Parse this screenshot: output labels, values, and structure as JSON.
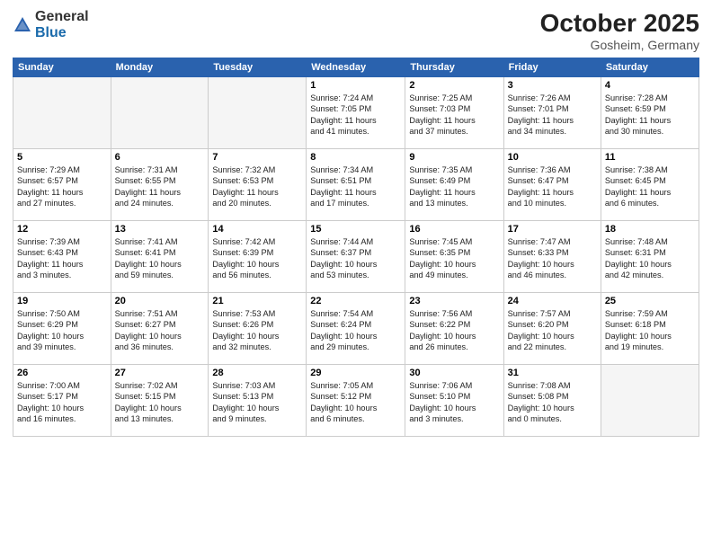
{
  "logo": {
    "general": "General",
    "blue": "Blue"
  },
  "title": {
    "month": "October 2025",
    "location": "Gosheim, Germany"
  },
  "headers": [
    "Sunday",
    "Monday",
    "Tuesday",
    "Wednesday",
    "Thursday",
    "Friday",
    "Saturday"
  ],
  "weeks": [
    [
      {
        "day": "",
        "empty": true
      },
      {
        "day": "",
        "empty": true
      },
      {
        "day": "",
        "empty": true
      },
      {
        "day": "1",
        "lines": [
          "Sunrise: 7:24 AM",
          "Sunset: 7:05 PM",
          "Daylight: 11 hours",
          "and 41 minutes."
        ]
      },
      {
        "day": "2",
        "lines": [
          "Sunrise: 7:25 AM",
          "Sunset: 7:03 PM",
          "Daylight: 11 hours",
          "and 37 minutes."
        ]
      },
      {
        "day": "3",
        "lines": [
          "Sunrise: 7:26 AM",
          "Sunset: 7:01 PM",
          "Daylight: 11 hours",
          "and 34 minutes."
        ]
      },
      {
        "day": "4",
        "lines": [
          "Sunrise: 7:28 AM",
          "Sunset: 6:59 PM",
          "Daylight: 11 hours",
          "and 30 minutes."
        ]
      }
    ],
    [
      {
        "day": "5",
        "lines": [
          "Sunrise: 7:29 AM",
          "Sunset: 6:57 PM",
          "Daylight: 11 hours",
          "and 27 minutes."
        ]
      },
      {
        "day": "6",
        "lines": [
          "Sunrise: 7:31 AM",
          "Sunset: 6:55 PM",
          "Daylight: 11 hours",
          "and 24 minutes."
        ]
      },
      {
        "day": "7",
        "lines": [
          "Sunrise: 7:32 AM",
          "Sunset: 6:53 PM",
          "Daylight: 11 hours",
          "and 20 minutes."
        ]
      },
      {
        "day": "8",
        "lines": [
          "Sunrise: 7:34 AM",
          "Sunset: 6:51 PM",
          "Daylight: 11 hours",
          "and 17 minutes."
        ]
      },
      {
        "day": "9",
        "lines": [
          "Sunrise: 7:35 AM",
          "Sunset: 6:49 PM",
          "Daylight: 11 hours",
          "and 13 minutes."
        ]
      },
      {
        "day": "10",
        "lines": [
          "Sunrise: 7:36 AM",
          "Sunset: 6:47 PM",
          "Daylight: 11 hours",
          "and 10 minutes."
        ]
      },
      {
        "day": "11",
        "lines": [
          "Sunrise: 7:38 AM",
          "Sunset: 6:45 PM",
          "Daylight: 11 hours",
          "and 6 minutes."
        ]
      }
    ],
    [
      {
        "day": "12",
        "lines": [
          "Sunrise: 7:39 AM",
          "Sunset: 6:43 PM",
          "Daylight: 11 hours",
          "and 3 minutes."
        ]
      },
      {
        "day": "13",
        "lines": [
          "Sunrise: 7:41 AM",
          "Sunset: 6:41 PM",
          "Daylight: 10 hours",
          "and 59 minutes."
        ]
      },
      {
        "day": "14",
        "lines": [
          "Sunrise: 7:42 AM",
          "Sunset: 6:39 PM",
          "Daylight: 10 hours",
          "and 56 minutes."
        ]
      },
      {
        "day": "15",
        "lines": [
          "Sunrise: 7:44 AM",
          "Sunset: 6:37 PM",
          "Daylight: 10 hours",
          "and 53 minutes."
        ]
      },
      {
        "day": "16",
        "lines": [
          "Sunrise: 7:45 AM",
          "Sunset: 6:35 PM",
          "Daylight: 10 hours",
          "and 49 minutes."
        ]
      },
      {
        "day": "17",
        "lines": [
          "Sunrise: 7:47 AM",
          "Sunset: 6:33 PM",
          "Daylight: 10 hours",
          "and 46 minutes."
        ]
      },
      {
        "day": "18",
        "lines": [
          "Sunrise: 7:48 AM",
          "Sunset: 6:31 PM",
          "Daylight: 10 hours",
          "and 42 minutes."
        ]
      }
    ],
    [
      {
        "day": "19",
        "lines": [
          "Sunrise: 7:50 AM",
          "Sunset: 6:29 PM",
          "Daylight: 10 hours",
          "and 39 minutes."
        ]
      },
      {
        "day": "20",
        "lines": [
          "Sunrise: 7:51 AM",
          "Sunset: 6:27 PM",
          "Daylight: 10 hours",
          "and 36 minutes."
        ]
      },
      {
        "day": "21",
        "lines": [
          "Sunrise: 7:53 AM",
          "Sunset: 6:26 PM",
          "Daylight: 10 hours",
          "and 32 minutes."
        ]
      },
      {
        "day": "22",
        "lines": [
          "Sunrise: 7:54 AM",
          "Sunset: 6:24 PM",
          "Daylight: 10 hours",
          "and 29 minutes."
        ]
      },
      {
        "day": "23",
        "lines": [
          "Sunrise: 7:56 AM",
          "Sunset: 6:22 PM",
          "Daylight: 10 hours",
          "and 26 minutes."
        ]
      },
      {
        "day": "24",
        "lines": [
          "Sunrise: 7:57 AM",
          "Sunset: 6:20 PM",
          "Daylight: 10 hours",
          "and 22 minutes."
        ]
      },
      {
        "day": "25",
        "lines": [
          "Sunrise: 7:59 AM",
          "Sunset: 6:18 PM",
          "Daylight: 10 hours",
          "and 19 minutes."
        ]
      }
    ],
    [
      {
        "day": "26",
        "lines": [
          "Sunrise: 7:00 AM",
          "Sunset: 5:17 PM",
          "Daylight: 10 hours",
          "and 16 minutes."
        ]
      },
      {
        "day": "27",
        "lines": [
          "Sunrise: 7:02 AM",
          "Sunset: 5:15 PM",
          "Daylight: 10 hours",
          "and 13 minutes."
        ]
      },
      {
        "day": "28",
        "lines": [
          "Sunrise: 7:03 AM",
          "Sunset: 5:13 PM",
          "Daylight: 10 hours",
          "and 9 minutes."
        ]
      },
      {
        "day": "29",
        "lines": [
          "Sunrise: 7:05 AM",
          "Sunset: 5:12 PM",
          "Daylight: 10 hours",
          "and 6 minutes."
        ]
      },
      {
        "day": "30",
        "lines": [
          "Sunrise: 7:06 AM",
          "Sunset: 5:10 PM",
          "Daylight: 10 hours",
          "and 3 minutes."
        ]
      },
      {
        "day": "31",
        "lines": [
          "Sunrise: 7:08 AM",
          "Sunset: 5:08 PM",
          "Daylight: 10 hours",
          "and 0 minutes."
        ]
      },
      {
        "day": "",
        "empty": true
      }
    ]
  ]
}
